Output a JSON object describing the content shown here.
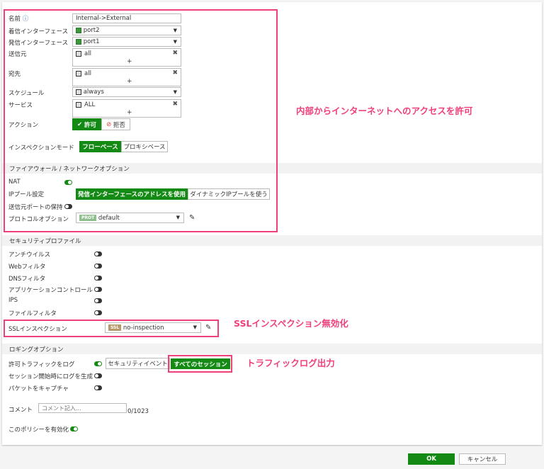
{
  "form": {
    "name_label": "名前",
    "name_value": "Internal->External",
    "info_icon": "info-icon",
    "incoming_label": "着信インターフェース",
    "incoming_value": "port2",
    "outgoing_label": "発信インターフェース",
    "outgoing_value": "port1",
    "source_label": "送信元",
    "source_value": "all",
    "dest_label": "宛先",
    "dest_value": "all",
    "schedule_label": "スケジュール",
    "schedule_value": "always",
    "service_label": "サービス",
    "service_value": "ALL",
    "action_label": "アクション",
    "action_accept": "許可",
    "action_deny": "拒否",
    "inspection_label": "インスペクションモード",
    "inspection_flow": "フローベース",
    "inspection_proxy": "プロキシベース",
    "plus": "+",
    "remove": "✖"
  },
  "firewall": {
    "header": "ファイアウォール / ネットワークオプション",
    "nat_label": "NAT",
    "nat_on": true,
    "ippool_label": "IPプール設定",
    "ippool_outgoing": "発信インターフェースのアドレスを使用",
    "ippool_dynamic": "ダイナミックIPプールを使う",
    "preserve_port_label": "送信元ポートの保持",
    "preserve_port_on": false,
    "protocol_label": "プロトコルオプション",
    "protocol_tag": "PROT",
    "protocol_value": "default"
  },
  "security": {
    "header": "セキュリティプロファイル",
    "items": [
      {
        "label": "アンチウイルス",
        "on": false
      },
      {
        "label": "Webフィルタ",
        "on": false
      },
      {
        "label": "DNSフィルタ",
        "on": false
      },
      {
        "label": "アプリケーションコントロール",
        "on": false
      },
      {
        "label": "IPS",
        "on": false
      },
      {
        "label": "ファイルフィルタ",
        "on": false
      }
    ],
    "ssl_label": "SSLインスペクション",
    "ssl_tag": "SSL",
    "ssl_value": "no-inspection"
  },
  "logging": {
    "header": "ロギングオプション",
    "log_allowed_label": "許可トラフィックをログ",
    "log_allowed_on": true,
    "log_security": "セキュリティイベント",
    "log_all": "すべてのセッション",
    "log_start_label": "セッション開始時にログを生成",
    "log_start_on": false,
    "capture_label": "パケットをキャプチャ",
    "capture_on": false,
    "comment_label": "コメント",
    "comment_placeholder": "コメント記入...",
    "comment_count": "0/1023",
    "enable_label": "このポリシーを有効化",
    "enable_on": true
  },
  "annotations": {
    "allow_internet": "内部からインターネットへのアクセスを許可",
    "ssl_disabled": "SSLインスペクション無効化",
    "traffic_log": "トラフィックログ出力",
    "color": "#f0407a"
  },
  "footer": {
    "ok": "OK",
    "cancel": "キャンセル"
  },
  "colors": {
    "accent": "#138a13"
  }
}
